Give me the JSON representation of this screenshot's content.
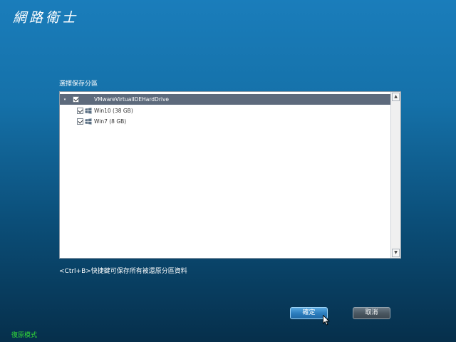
{
  "app": {
    "title": "網路衛士"
  },
  "section": {
    "label": "選擇保存分區"
  },
  "tree": {
    "root": {
      "expander": "▾",
      "label": "VMwareVirtualIDEHardDrive",
      "checked": true,
      "selected": true
    },
    "items": [
      {
        "label": "Win10 (38 GB)",
        "checked": true,
        "icon": "windows-icon"
      },
      {
        "label": "Win7 (8 GB)",
        "checked": true,
        "icon": "windows-icon"
      }
    ]
  },
  "scrollbar": {
    "up": "▲",
    "down": "▼"
  },
  "hint": "<Ctrl+B>快捷鍵可保存所有被還原分區資料",
  "buttons": {
    "ok": "確定",
    "cancel": "取消"
  },
  "footer": {
    "mode": "復原模式"
  },
  "colors": {
    "background_top": "#1a7dbb",
    "background_bottom": "#062f4b",
    "selection": "#5d6a7c",
    "ok_button": "#2d7fc0",
    "cancel_button": "#4b5862",
    "mode_text": "#32d838"
  }
}
